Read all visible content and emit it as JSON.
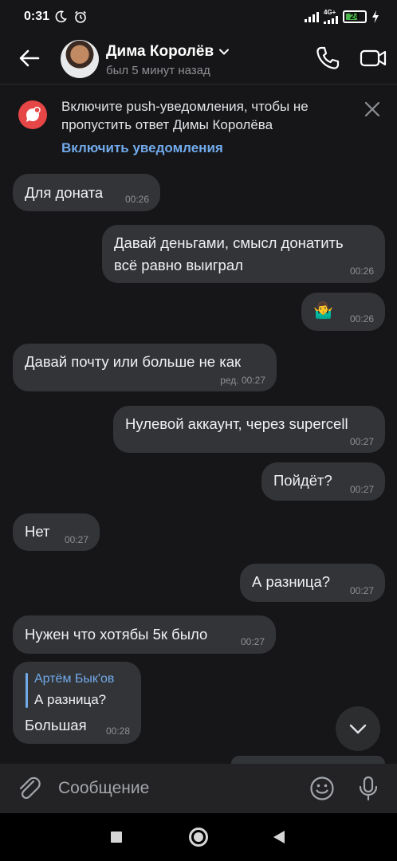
{
  "status_bar": {
    "time": "0:31",
    "network_type": "4G+",
    "battery_level": "24",
    "icons": [
      "moon-icon",
      "alarm-icon",
      "signal-icon",
      "battery-icon",
      "charging-icon"
    ]
  },
  "header": {
    "contact_name": "Дима Королёв",
    "contact_status": "был 5 минут назад"
  },
  "banner": {
    "text": "Включите push-уведомления, чтобы не пропустить ответ Димы Королёва",
    "link": "Включить уведомления"
  },
  "messages": [
    {
      "text": "Для доната",
      "time": "00:26",
      "direction": "incoming"
    },
    {
      "text_line1": "Давай деньгами, смысл донатить",
      "text_line2": "всё равно выиграл",
      "time": "00:26",
      "direction": "outgoing"
    },
    {
      "emoji": "🤷‍♂️",
      "time": "00:26",
      "direction": "outgoing"
    },
    {
      "text": "Давай почту или больше не как",
      "time": "ред. 00:27",
      "direction": "incoming"
    },
    {
      "text": "Нулевой аккаунт, через supercell",
      "time": "00:27",
      "direction": "outgoing"
    },
    {
      "text": "Пойдёт?",
      "time": "00:27",
      "direction": "outgoing"
    },
    {
      "text": "Нет",
      "time": "00:27",
      "direction": "incoming"
    },
    {
      "text": "А разница?",
      "time": "00:27",
      "direction": "outgoing"
    },
    {
      "text": "Нужен что хотябы 5к было",
      "time": "00:27",
      "direction": "incoming"
    },
    {
      "reply_author": "Артём Бык'ов",
      "reply_text": "А разница?",
      "text": "Большая",
      "time": "00:28",
      "direction": "incoming"
    }
  ],
  "composer": {
    "placeholder": "Сообщение"
  },
  "colors": {
    "background": "#161618",
    "bubble": "#333437",
    "accent_link": "#71aaeb",
    "banner_icon": "#e64646",
    "battery_fill": "#4bb34b"
  }
}
